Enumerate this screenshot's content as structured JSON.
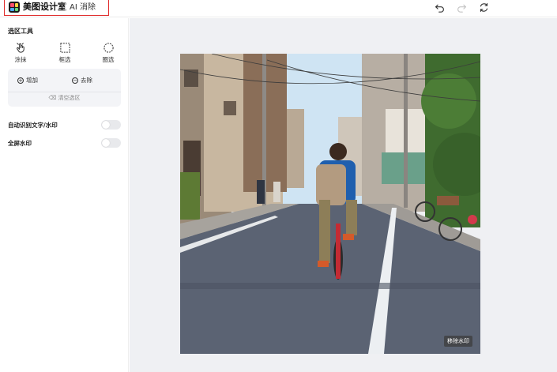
{
  "app": {
    "brand_name": "美图设计室",
    "product_name": "AI 消除"
  },
  "toolbar": {
    "undo_icon": "undo-icon",
    "redo_icon": "redo-icon",
    "reset_icon": "refresh-icon"
  },
  "sidebar": {
    "section_title": "选区工具",
    "tools": [
      {
        "label": "涂抹",
        "icon": "hand-brush-icon"
      },
      {
        "label": "框选",
        "icon": "rect-select-icon"
      },
      {
        "label": "圈选",
        "icon": "lasso-icon"
      }
    ],
    "add_label": "增加",
    "remove_label": "去除",
    "clear_label": "清空选区",
    "options": [
      {
        "label": "自动识别文字/水印",
        "enabled": false
      },
      {
        "label": "全屏水印",
        "enabled": false
      }
    ]
  },
  "canvas": {
    "watermark_badge": "移除水印"
  },
  "colors": {
    "accent_highlight": "#e02b2b",
    "canvas_bg": "#eff0f3",
    "panel_bg": "#f3f4f7"
  }
}
